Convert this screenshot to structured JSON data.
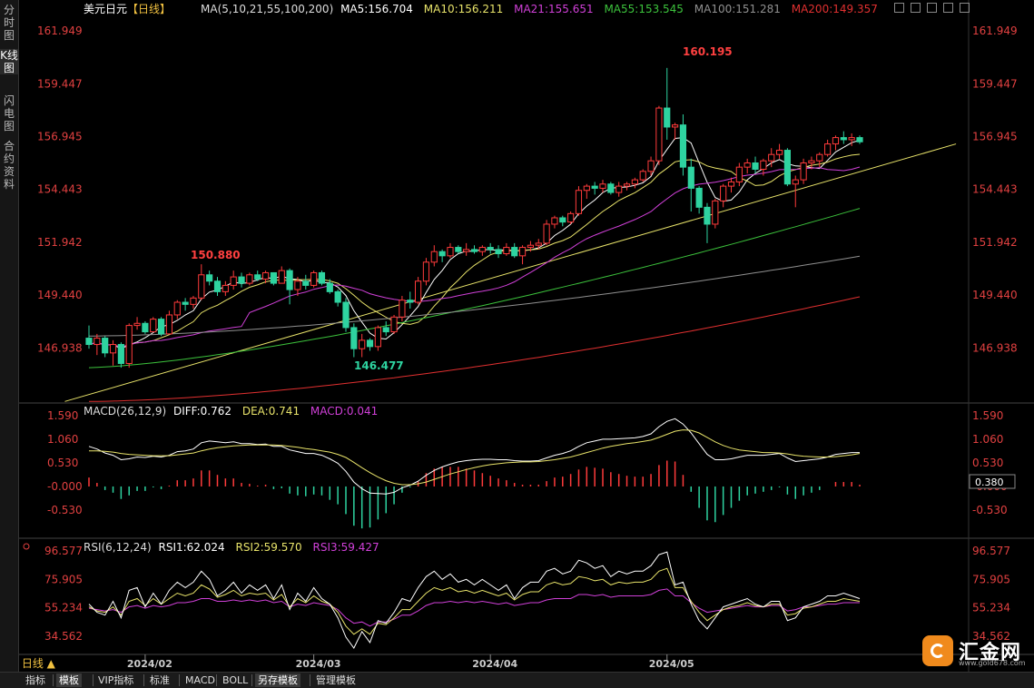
{
  "sidebar": [
    "分时图",
    "K线图",
    "闪电图",
    "合约资料"
  ],
  "header": {
    "symbol": "美元日元",
    "period_tag": "【日线】",
    "ma_label": "MA(5,10,21,55,100,200)",
    "ma5": "MA5:156.704",
    "ma10": "MA10:156.211",
    "ma21": "MA21:155.651",
    "ma55": "MA55:153.545",
    "ma100": "MA100:151.281",
    "ma200": "MA200:149.357"
  },
  "macd_header": {
    "label": "MACD(26,12,9)",
    "diff": "DIFF:0.762",
    "dea": "DEA:0.741",
    "macd": "MACD:0.041"
  },
  "rsi_header": {
    "label": "RSI(6,12,24)",
    "rsi1": "RSI1:62.024",
    "rsi2": "RSI2:59.570",
    "rsi3": "RSI3:59.427"
  },
  "annotations": {
    "high": "160.195",
    "mid_high": "150.880",
    "low": "146.477"
  },
  "macd_current": "0.380",
  "period_label": "日线 ▲",
  "bottom_tabs": [
    "指标",
    "模板",
    "VIP指标",
    "标准",
    "MACD",
    "BOLL",
    "另存模板",
    "管理模板"
  ],
  "logo": {
    "name": "汇金网",
    "url": "www.gold678.com"
  },
  "colors": {
    "up": "#ff3b3b",
    "down": "#2ed3a0",
    "ma5": "#ffffff",
    "ma10": "#e8e36a",
    "ma21": "#d040d8",
    "ma55": "#3cc23c",
    "ma100": "#909090",
    "ma200": "#e03030",
    "trend": "#e8e36a",
    "price_axis": "#e04040"
  },
  "chart_data": [
    {
      "type": "candlestick",
      "title": "美元日元 【日线】",
      "y_ticks": [
        "161.949",
        "159.447",
        "156.945",
        "154.443",
        "151.942",
        "149.440",
        "146.938"
      ],
      "x_ticks": [
        "2024/02",
        "2024/03",
        "2024/04",
        "2024/05"
      ],
      "ylim": [
        144.5,
        162.3
      ],
      "candles": [
        [
          147.4,
          148.0,
          146.9,
          147.1
        ],
        [
          147.1,
          147.6,
          146.6,
          147.4
        ],
        [
          147.4,
          147.5,
          146.5,
          146.7
        ],
        [
          146.7,
          147.3,
          146.1,
          147.1
        ],
        [
          147.1,
          147.2,
          146.0,
          146.2
        ],
        [
          146.2,
          148.1,
          146.0,
          148.0
        ],
        [
          148.0,
          148.4,
          147.8,
          148.1
        ],
        [
          148.1,
          148.2,
          147.6,
          147.7
        ],
        [
          147.7,
          148.4,
          147.7,
          148.3
        ],
        [
          148.3,
          148.4,
          147.5,
          147.6
        ],
        [
          147.6,
          148.7,
          147.6,
          148.5
        ],
        [
          148.5,
          149.2,
          148.3,
          149.1
        ],
        [
          149.1,
          149.3,
          148.7,
          149.0
        ],
        [
          149.0,
          149.4,
          148.8,
          149.3
        ],
        [
          149.3,
          150.9,
          149.2,
          150.4
        ],
        [
          150.4,
          150.6,
          149.9,
          150.1
        ],
        [
          150.1,
          150.3,
          149.4,
          149.6
        ],
        [
          149.6,
          150.1,
          149.4,
          149.9
        ],
        [
          149.9,
          150.6,
          149.7,
          150.3
        ],
        [
          150.3,
          150.5,
          149.8,
          150.0
        ],
        [
          150.0,
          150.5,
          149.9,
          150.4
        ],
        [
          150.4,
          150.6,
          150.1,
          150.2
        ],
        [
          150.2,
          150.6,
          150.0,
          150.5
        ],
        [
          150.5,
          150.5,
          149.9,
          150.0
        ],
        [
          150.0,
          150.8,
          150.0,
          150.6
        ],
        [
          150.6,
          150.7,
          149.0,
          149.7
        ],
        [
          149.7,
          150.3,
          149.4,
          150.1
        ],
        [
          150.1,
          150.4,
          149.7,
          149.9
        ],
        [
          149.9,
          150.6,
          149.8,
          150.5
        ],
        [
          150.5,
          150.6,
          149.9,
          150.0
        ],
        [
          150.0,
          150.2,
          149.5,
          149.6
        ],
        [
          149.6,
          149.7,
          148.9,
          149.1
        ],
        [
          149.1,
          149.3,
          147.7,
          147.9
        ],
        [
          147.9,
          148.1,
          146.5,
          146.9
        ],
        [
          146.9,
          147.6,
          146.5,
          147.3
        ],
        [
          147.3,
          147.4,
          146.8,
          147.0
        ],
        [
          147.0,
          148.0,
          146.8,
          147.9
        ],
        [
          147.9,
          148.2,
          147.5,
          147.7
        ],
        [
          147.7,
          148.5,
          147.6,
          148.4
        ],
        [
          148.4,
          149.4,
          148.2,
          149.2
        ],
        [
          149.2,
          149.6,
          148.8,
          149.1
        ],
        [
          149.1,
          150.3,
          149.0,
          150.1
        ],
        [
          150.1,
          151.2,
          149.9,
          151.0
        ],
        [
          151.0,
          151.8,
          150.8,
          151.5
        ],
        [
          151.5,
          151.6,
          151.0,
          151.3
        ],
        [
          151.3,
          151.9,
          151.2,
          151.7
        ],
        [
          151.7,
          151.8,
          151.4,
          151.5
        ],
        [
          151.5,
          151.9,
          151.3,
          151.6
        ],
        [
          151.6,
          151.8,
          151.4,
          151.5
        ],
        [
          151.5,
          151.8,
          151.3,
          151.7
        ],
        [
          151.7,
          151.9,
          151.4,
          151.6
        ],
        [
          151.6,
          151.8,
          151.2,
          151.4
        ],
        [
          151.4,
          151.9,
          151.3,
          151.7
        ],
        [
          151.7,
          151.9,
          151.2,
          151.3
        ],
        [
          151.3,
          151.8,
          150.9,
          151.7
        ],
        [
          151.7,
          152.0,
          151.5,
          151.8
        ],
        [
          151.8,
          152.1,
          151.6,
          151.9
        ],
        [
          151.9,
          153.0,
          151.8,
          152.8
        ],
        [
          152.8,
          153.2,
          152.6,
          153.1
        ],
        [
          153.1,
          153.2,
          152.7,
          152.9
        ],
        [
          152.9,
          153.4,
          152.8,
          153.3
        ],
        [
          153.3,
          154.6,
          153.2,
          154.4
        ],
        [
          154.4,
          154.7,
          154.0,
          154.6
        ],
        [
          154.6,
          154.8,
          154.2,
          154.5
        ],
        [
          154.5,
          154.9,
          154.3,
          154.7
        ],
        [
          154.7,
          154.8,
          154.2,
          154.3
        ],
        [
          154.3,
          154.8,
          154.1,
          154.6
        ],
        [
          154.6,
          154.8,
          154.4,
          154.7
        ],
        [
          154.7,
          155.0,
          154.5,
          154.9
        ],
        [
          154.9,
          155.4,
          154.8,
          155.3
        ],
        [
          155.3,
          156.0,
          155.1,
          155.8
        ],
        [
          155.8,
          158.4,
          155.6,
          158.3
        ],
        [
          158.3,
          160.2,
          156.8,
          157.4
        ],
        [
          157.4,
          157.6,
          156.8,
          157.5
        ],
        [
          157.5,
          158.0,
          155.1,
          155.5
        ],
        [
          155.5,
          155.9,
          153.4,
          154.5
        ],
        [
          154.5,
          154.6,
          153.3,
          153.6
        ],
        [
          153.6,
          153.8,
          151.9,
          152.8
        ],
        [
          152.8,
          154.0,
          152.6,
          153.9
        ],
        [
          153.9,
          154.7,
          153.6,
          154.6
        ],
        [
          154.6,
          155.0,
          154.3,
          154.8
        ],
        [
          154.8,
          155.7,
          154.6,
          155.5
        ],
        [
          155.5,
          155.9,
          155.2,
          155.7
        ],
        [
          155.7,
          156.0,
          155.2,
          155.4
        ],
        [
          155.4,
          155.9,
          155.1,
          155.8
        ],
        [
          155.8,
          156.4,
          155.5,
          156.1
        ],
        [
          156.1,
          156.6,
          155.9,
          156.3
        ],
        [
          156.3,
          156.4,
          154.6,
          154.7
        ],
        [
          154.7,
          155.1,
          153.6,
          154.9
        ],
        [
          154.9,
          155.9,
          154.7,
          155.7
        ],
        [
          155.7,
          156.0,
          155.4,
          155.8
        ],
        [
          155.8,
          156.2,
          155.5,
          156.1
        ],
        [
          156.1,
          156.8,
          156.0,
          156.6
        ],
        [
          156.6,
          157.0,
          156.3,
          156.9
        ],
        [
          156.9,
          157.2,
          156.6,
          156.8
        ],
        [
          156.8,
          157.1,
          156.5,
          156.9
        ],
        [
          156.9,
          157.0,
          156.6,
          156.7
        ]
      ],
      "ma_series": [
        {
          "name": "MA5",
          "value": 156.704
        },
        {
          "name": "MA10",
          "value": 156.211
        },
        {
          "name": "MA21",
          "value": 155.651
        },
        {
          "name": "MA55",
          "value": 153.545
        },
        {
          "name": "MA100",
          "value": 151.281
        },
        {
          "name": "MA200",
          "value": 149.357
        }
      ]
    },
    {
      "type": "bar",
      "title": "MACD(26,12,9)",
      "y_ticks": [
        "1.590",
        "1.060",
        "0.530",
        "-0.000",
        "-0.530"
      ],
      "ylim": [
        -1.1,
        1.75
      ],
      "series": [
        {
          "name": "DIFF",
          "values": [
            0.9,
            0.84,
            0.75,
            0.7,
            0.6,
            0.62,
            0.66,
            0.65,
            0.68,
            0.66,
            0.7,
            0.78,
            0.8,
            0.84,
            0.98,
            1.02,
            1.0,
            0.98,
            1.0,
            0.96,
            0.96,
            0.94,
            0.95,
            0.9,
            0.9,
            0.82,
            0.78,
            0.74,
            0.74,
            0.7,
            0.62,
            0.52,
            0.34,
            0.1,
            -0.05,
            -0.15,
            -0.16,
            -0.17,
            -0.13,
            -0.03,
            0.03,
            0.12,
            0.25,
            0.36,
            0.44,
            0.5,
            0.55,
            0.58,
            0.6,
            0.61,
            0.61,
            0.6,
            0.6,
            0.58,
            0.57,
            0.57,
            0.58,
            0.64,
            0.7,
            0.74,
            0.8,
            0.9,
            0.98,
            1.02,
            1.06,
            1.06,
            1.07,
            1.08,
            1.09,
            1.12,
            1.18,
            1.34,
            1.46,
            1.52,
            1.4,
            1.2,
            0.96,
            0.72,
            0.6,
            0.6,
            0.62,
            0.66,
            0.7,
            0.7,
            0.7,
            0.72,
            0.74,
            0.64,
            0.56,
            0.58,
            0.6,
            0.62,
            0.66,
            0.72,
            0.74,
            0.76,
            0.76
          ]
        },
        {
          "name": "DEA",
          "values": [
            0.8,
            0.8,
            0.79,
            0.77,
            0.74,
            0.72,
            0.71,
            0.7,
            0.69,
            0.69,
            0.69,
            0.71,
            0.73,
            0.75,
            0.8,
            0.84,
            0.87,
            0.89,
            0.91,
            0.92,
            0.93,
            0.93,
            0.93,
            0.93,
            0.92,
            0.9,
            0.88,
            0.85,
            0.83,
            0.8,
            0.77,
            0.72,
            0.65,
            0.54,
            0.42,
            0.31,
            0.21,
            0.13,
            0.07,
            0.04,
            0.04,
            0.06,
            0.1,
            0.16,
            0.22,
            0.28,
            0.33,
            0.38,
            0.42,
            0.46,
            0.49,
            0.51,
            0.53,
            0.54,
            0.55,
            0.55,
            0.56,
            0.58,
            0.6,
            0.63,
            0.66,
            0.71,
            0.76,
            0.81,
            0.86,
            0.9,
            0.93,
            0.96,
            0.98,
            1.01,
            1.04,
            1.1,
            1.17,
            1.24,
            1.27,
            1.26,
            1.2,
            1.1,
            1.0,
            0.92,
            0.86,
            0.82,
            0.8,
            0.78,
            0.76,
            0.76,
            0.75,
            0.73,
            0.7,
            0.68,
            0.67,
            0.66,
            0.66,
            0.67,
            0.69,
            0.71,
            0.74
          ]
        }
      ]
    },
    {
      "type": "line",
      "title": "RSI(6,12,24)",
      "y_ticks": [
        "96.577",
        "75.905",
        "55.234",
        "34.562"
      ],
      "ylim": [
        22,
        104
      ],
      "series": [
        {
          "name": "RSI1",
          "values": [
            58,
            52,
            50,
            60,
            48,
            68,
            70,
            56,
            66,
            58,
            68,
            74,
            70,
            74,
            82,
            76,
            64,
            68,
            74,
            66,
            72,
            68,
            72,
            62,
            72,
            54,
            66,
            60,
            70,
            62,
            58,
            48,
            34,
            26,
            38,
            30,
            46,
            44,
            52,
            62,
            60,
            70,
            78,
            82,
            76,
            80,
            74,
            76,
            72,
            76,
            72,
            68,
            72,
            62,
            70,
            74,
            74,
            82,
            84,
            80,
            82,
            90,
            88,
            84,
            86,
            78,
            82,
            80,
            82,
            82,
            86,
            94,
            96,
            72,
            74,
            58,
            46,
            40,
            48,
            56,
            58,
            60,
            62,
            58,
            56,
            60,
            60,
            46,
            48,
            56,
            58,
            60,
            64,
            64,
            66,
            64,
            62
          ]
        },
        {
          "name": "RSI2",
          "values": [
            56,
            53,
            52,
            56,
            50,
            60,
            62,
            57,
            62,
            58,
            62,
            66,
            64,
            66,
            72,
            69,
            63,
            65,
            68,
            64,
            66,
            65,
            66,
            61,
            65,
            56,
            62,
            59,
            64,
            60,
            58,
            52,
            42,
            36,
            40,
            36,
            44,
            43,
            48,
            54,
            54,
            60,
            66,
            70,
            68,
            70,
            67,
            68,
            66,
            68,
            66,
            64,
            66,
            61,
            65,
            67,
            67,
            72,
            74,
            72,
            73,
            78,
            77,
            75,
            76,
            72,
            74,
            73,
            74,
            74,
            76,
            82,
            84,
            70,
            70,
            60,
            52,
            46,
            50,
            54,
            56,
            57,
            59,
            57,
            56,
            58,
            58,
            50,
            51,
            55,
            56,
            58,
            60,
            60,
            62,
            61,
            60
          ]
        },
        {
          "name": "RSI3",
          "values": [
            55,
            54,
            53,
            54,
            52,
            56,
            57,
            55,
            57,
            56,
            57,
            59,
            59,
            60,
            62,
            62,
            60,
            60,
            61,
            60,
            61,
            60,
            61,
            59,
            60,
            56,
            58,
            57,
            59,
            58,
            57,
            54,
            48,
            44,
            45,
            42,
            45,
            45,
            47,
            50,
            50,
            53,
            57,
            59,
            59,
            60,
            59,
            60,
            59,
            60,
            59,
            58,
            59,
            57,
            58,
            59,
            59,
            61,
            62,
            62,
            62,
            65,
            65,
            64,
            65,
            63,
            64,
            64,
            64,
            64,
            65,
            68,
            69,
            64,
            64,
            59,
            55,
            52,
            53,
            54,
            55,
            56,
            57,
            56,
            56,
            57,
            57,
            53,
            54,
            56,
            56,
            57,
            58,
            58,
            59,
            59,
            59
          ]
        }
      ]
    }
  ]
}
